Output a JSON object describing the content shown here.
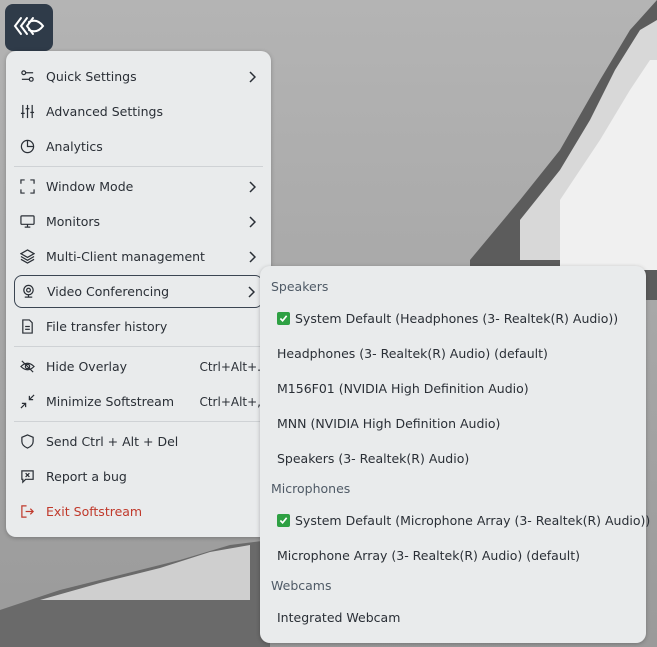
{
  "app": {
    "logo_icon": "softstream-logo-icon"
  },
  "menu": {
    "items": [
      {
        "id": "quick-settings",
        "label": "Quick Settings",
        "icon": "sliders-toggle-icon",
        "submenu": true
      },
      {
        "id": "advanced-settings",
        "label": "Advanced Settings",
        "icon": "equalizer-icon"
      },
      {
        "id": "analytics",
        "label": "Analytics",
        "icon": "pie-chart-icon"
      },
      {
        "id": "window-mode",
        "label": "Window Mode",
        "icon": "fullscreen-corners-icon",
        "submenu": true
      },
      {
        "id": "monitors",
        "label": "Monitors",
        "icon": "monitor-icon",
        "submenu": true
      },
      {
        "id": "multi-client",
        "label": "Multi-Client management",
        "icon": "layers-icon",
        "submenu": true
      },
      {
        "id": "video-conferencing",
        "label": "Video Conferencing",
        "icon": "webcam-icon",
        "submenu": true,
        "active": true
      },
      {
        "id": "file-transfer",
        "label": "File transfer history",
        "icon": "document-icon"
      },
      {
        "id": "hide-overlay",
        "label": "Hide Overlay",
        "icon": "eye-off-icon",
        "shortcut": "Ctrl+Alt+."
      },
      {
        "id": "minimize",
        "label": "Minimize Softstream",
        "icon": "minimize-arrows-icon",
        "shortcut": "Ctrl+Alt+,"
      },
      {
        "id": "send-cad",
        "label": "Send Ctrl + Alt + Del",
        "icon": "shield-icon"
      },
      {
        "id": "report-bug",
        "label": "Report a bug",
        "icon": "bug-report-icon"
      },
      {
        "id": "exit",
        "label": "Exit Softstream",
        "icon": "logout-icon",
        "danger": true
      }
    ]
  },
  "video_conferencing": {
    "speakers_header": "Speakers",
    "speakers": [
      {
        "label": "System Default (Headphones (3- Realtek(R) Audio))",
        "selected": true
      },
      {
        "label": "Headphones (3- Realtek(R) Audio) (default)"
      },
      {
        "label": "M156F01 (NVIDIA High Definition Audio)"
      },
      {
        "label": "MNN (NVIDIA High Definition Audio)"
      },
      {
        "label": "Speakers (3- Realtek(R) Audio)"
      }
    ],
    "microphones_header": "Microphones",
    "microphones": [
      {
        "label": "System Default (Microphone Array (3- Realtek(R) Audio))",
        "selected": true
      },
      {
        "label": "Microphone Array (3- Realtek(R) Audio) (default)"
      }
    ],
    "webcams_header": "Webcams",
    "webcams": [
      {
        "label": "Integrated Webcam"
      }
    ]
  },
  "colors": {
    "menu_bg": "#e9ebec",
    "logo_bg": "#2f3b49",
    "danger": "#c0392b",
    "check": "#2ea043"
  }
}
